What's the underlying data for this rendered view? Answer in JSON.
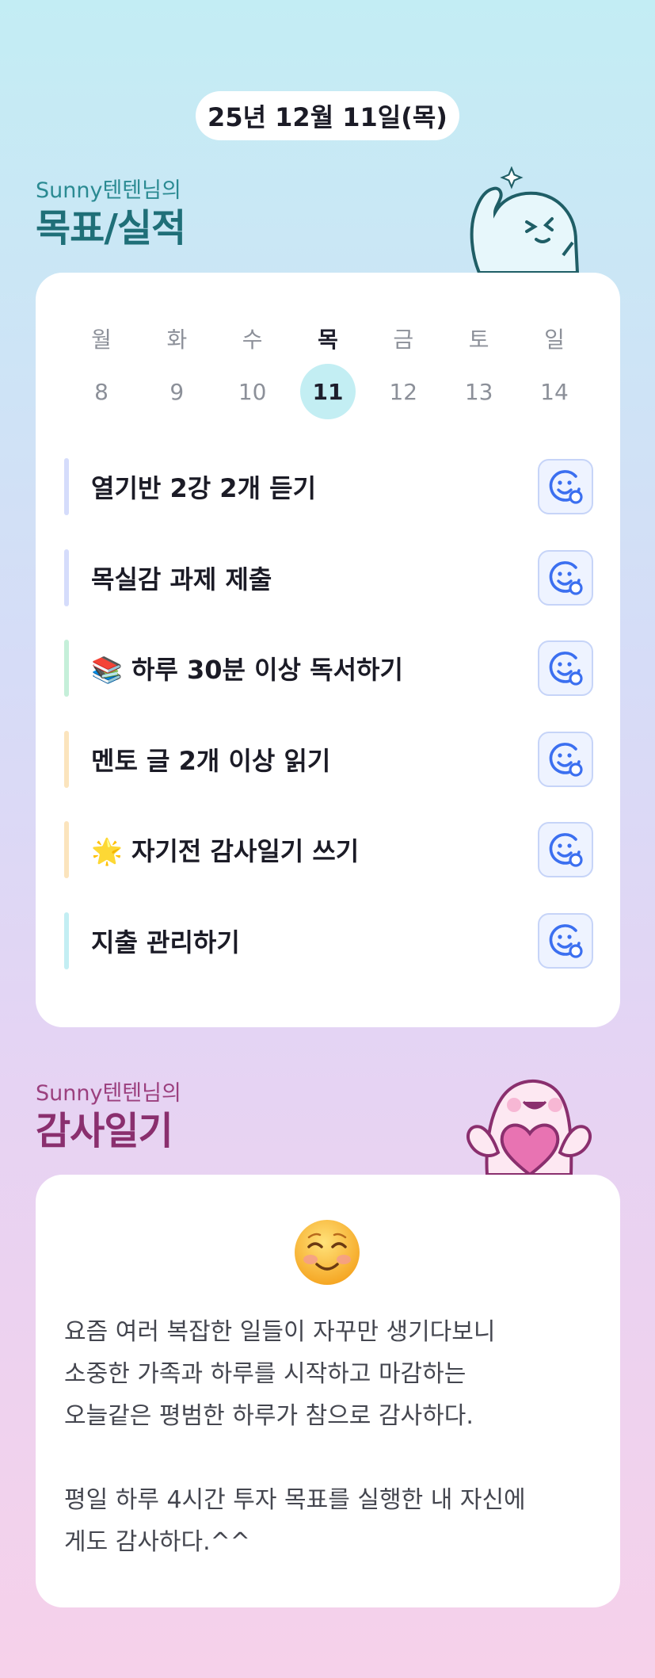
{
  "date_label": "25년 12월 11일(목)",
  "goals_section": {
    "subtitle": "Sunny텐텐님의",
    "title": "목표/실적"
  },
  "calendar": {
    "weekdays": [
      "월",
      "화",
      "수",
      "목",
      "금",
      "토",
      "일"
    ],
    "dates": [
      "8",
      "9",
      "10",
      "11",
      "12",
      "13",
      "14"
    ],
    "selected_index": 3
  },
  "goals": [
    {
      "text": "열기반 2강 2개 듣기",
      "bar_color": "#d5dcfb",
      "action_icon": "smiley-add-icon"
    },
    {
      "text": "목실감 과제 제출",
      "bar_color": "#d5dcfb",
      "action_icon": "smiley-add-icon"
    },
    {
      "text": "📚 하루 30분 이상 독서하기",
      "bar_color": "#c5efd9",
      "action_icon": "smiley-add-icon"
    },
    {
      "text": "멘토 글 2개 이상 읽기",
      "bar_color": "#fbe4bd",
      "action_icon": "smiley-add-icon"
    },
    {
      "text": "🌟 자기전 감사일기 쓰기",
      "bar_color": "#fbe4bd",
      "action_icon": "smiley-add-icon"
    },
    {
      "text": "지출 관리하기",
      "bar_color": "#c3eef3",
      "action_icon": "smiley-add-icon"
    }
  ],
  "thanks_section": {
    "subtitle": "Sunny텐텐님의",
    "title": "감사일기"
  },
  "diary": {
    "emoji": "smiling-face-emoji",
    "text": "요즘 여러 복잡한 일들이 자꾸만 생기다보니\n소중한 가족과 하루를 시작하고 마감하는\n오늘같은 평범한 하루가 참으로 감사하다.\n\n평일 하루 4시간 투자 목표를 실행한 내 자신에\n게도 감사하다.^^"
  },
  "colors": {
    "accent_teal": "#1f6f78",
    "accent_purple": "#8a2f6e",
    "today_highlight": "#c3eef3",
    "action_blue": "#3b6ff0"
  }
}
